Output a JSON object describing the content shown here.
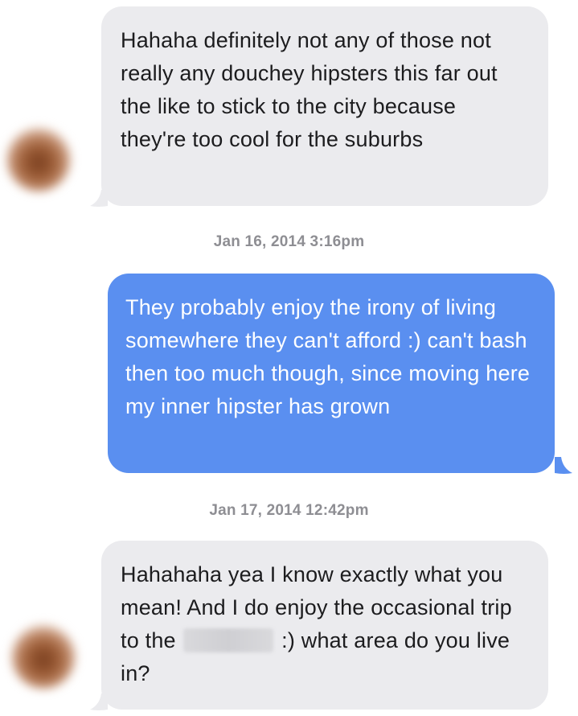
{
  "messages": [
    {
      "direction": "received",
      "text": "Hahaha definitely not any of those not really any douchey hipsters this far out the like to stick to the city because they're too cool for the suburbs"
    },
    {
      "direction": "sent",
      "timestamp": "Jan 16, 2014 3:16pm",
      "text": "They probably enjoy the irony of living somewhere they can't afford :) can't bash then too much though, since moving here my inner hipster has grown"
    },
    {
      "direction": "received",
      "timestamp": "Jan 17, 2014 12:42pm",
      "text_before": "Hahahaha yea I know exactly what you mean! And I do enjoy the occasional trip to the",
      "text_after": ":) what area do you live in?"
    }
  ],
  "colors": {
    "received_bubble": "#ebebee",
    "sent_bubble": "#5a8ff0",
    "timestamp_text": "#8e8e93"
  }
}
